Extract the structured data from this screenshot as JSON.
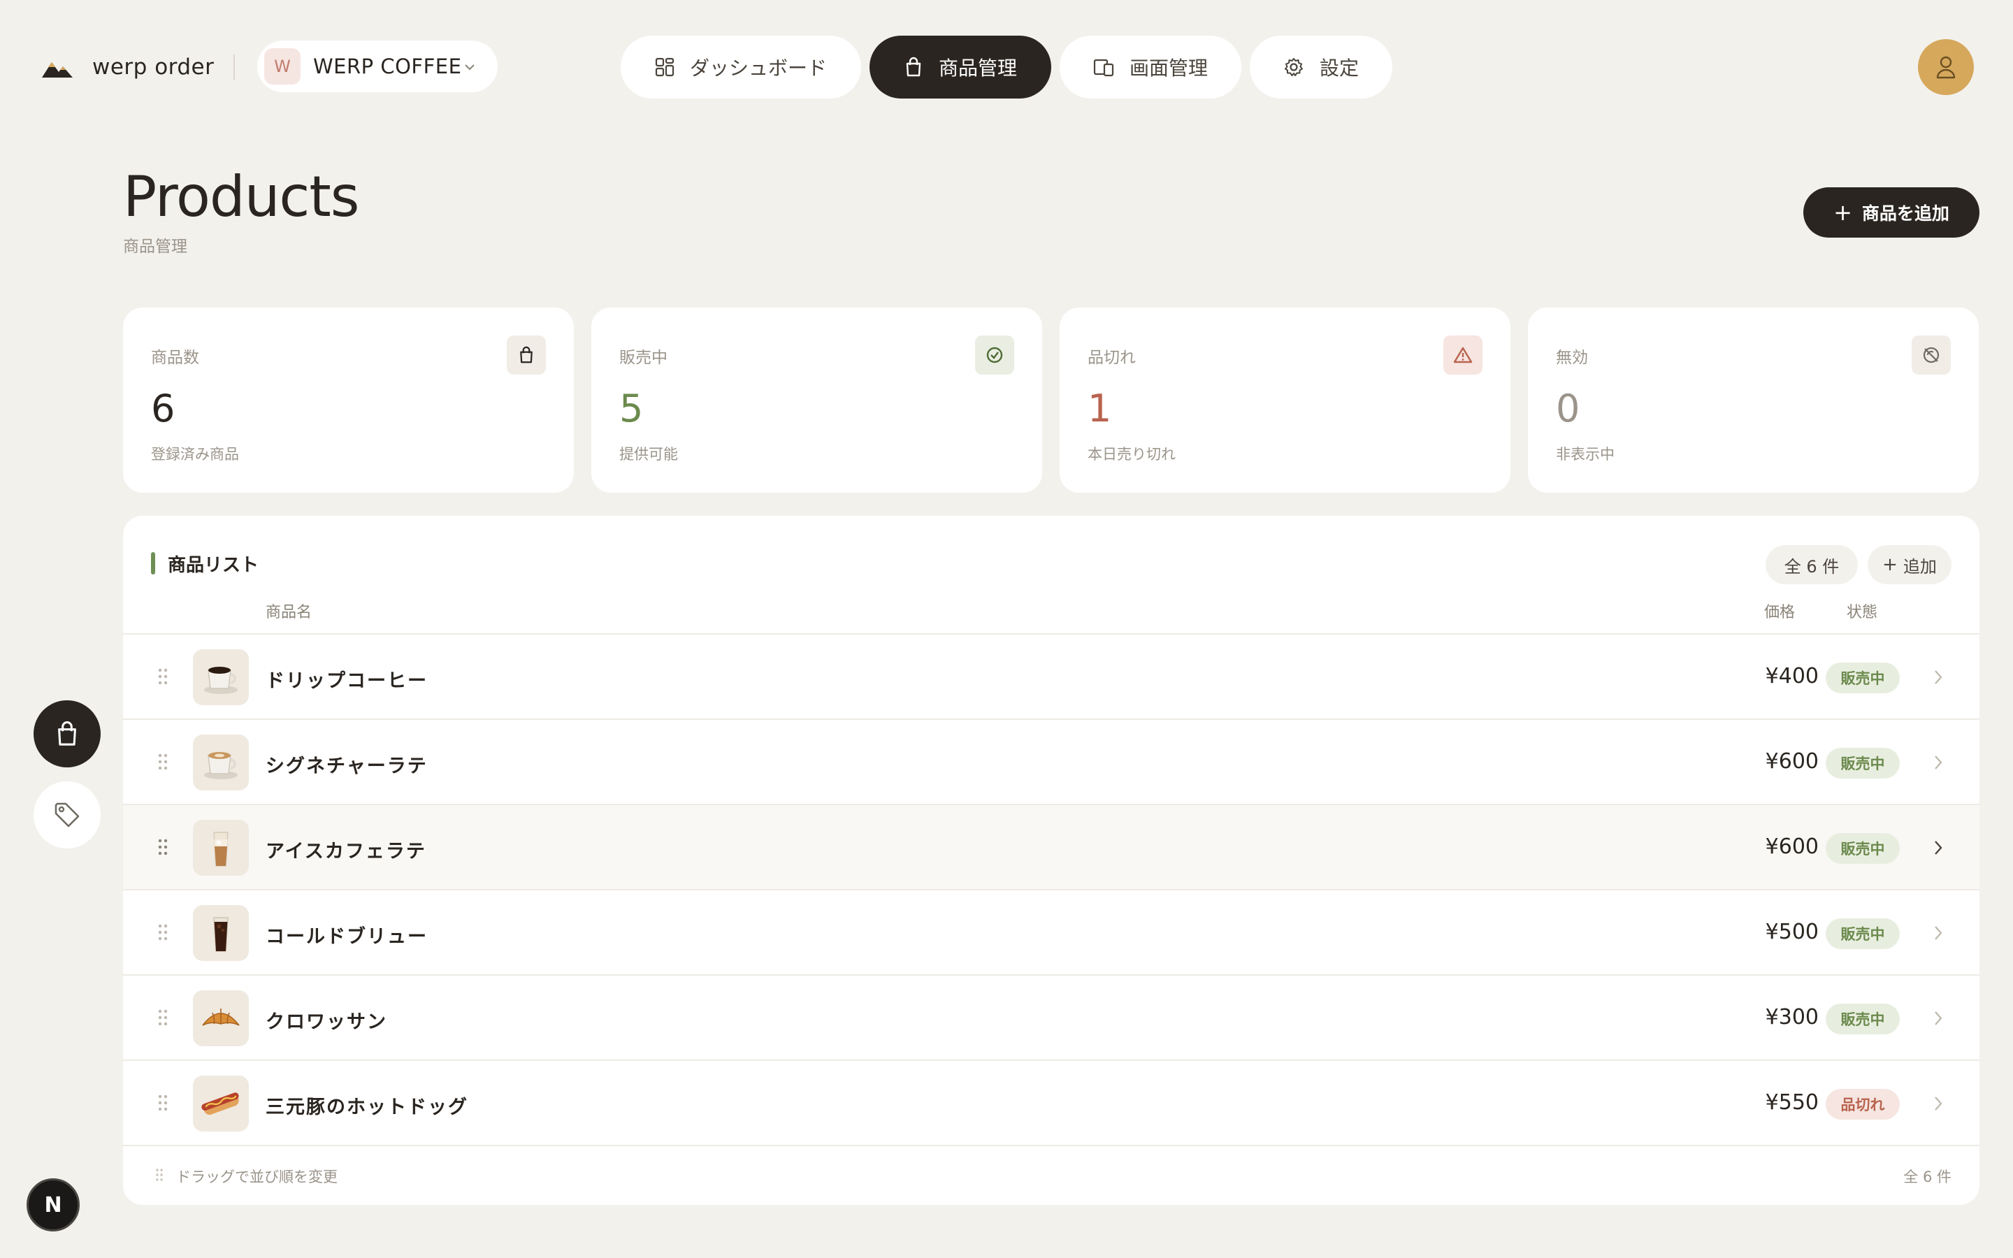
{
  "brand": {
    "name": "werp order"
  },
  "store": {
    "initial": "W",
    "name": "WERP COFFEE"
  },
  "nav": {
    "items": [
      {
        "label": "ダッシュボード",
        "icon": "dashboard-grid-icon"
      },
      {
        "label": "商品管理",
        "icon": "shopping-bag-icon",
        "active": true
      },
      {
        "label": "画面管理",
        "icon": "screens-icon"
      },
      {
        "label": "設定",
        "icon": "gear-icon"
      }
    ]
  },
  "page": {
    "title": "Products",
    "subtitle": "商品管理",
    "add_button_label": "商品を追加"
  },
  "stats": [
    {
      "label": "商品数",
      "value": "6",
      "sub": "登録済み商品",
      "icon": "shopping-bag-icon",
      "color": "#2a2520",
      "icon_bg": "#f1ede6"
    },
    {
      "label": "販売中",
      "value": "5",
      "sub": "提供可能",
      "icon": "check-circle-icon",
      "color": "#6b8a4d",
      "icon_bg": "#eaeee2"
    },
    {
      "label": "品切れ",
      "value": "1",
      "sub": "本日売り切れ",
      "icon": "warning-triangle-icon",
      "color": "#b9634e",
      "icon_bg": "#f6e5e0"
    },
    {
      "label": "無効",
      "value": "0",
      "sub": "非表示中",
      "icon": "hidden-circle-icon",
      "color": "#9a948a",
      "icon_bg": "#f1ede6"
    }
  ],
  "product_list": {
    "title": "商品リスト",
    "count_label": "全 6 件",
    "add_label": "追加",
    "columns": {
      "name": "商品名",
      "price": "価格",
      "status": "状態"
    },
    "rows": [
      {
        "name": "ドリップコーヒー",
        "price": "¥400",
        "status": "販売中",
        "state": "ok",
        "image": "hot-coffee-image"
      },
      {
        "name": "シグネチャーラテ",
        "price": "¥600",
        "status": "販売中",
        "state": "ok",
        "image": "latte-image"
      },
      {
        "name": "アイスカフェラテ",
        "price": "¥600",
        "status": "販売中",
        "state": "ok",
        "image": "iced-latte-image"
      },
      {
        "name": "コールドブリュー",
        "price": "¥500",
        "status": "販売中",
        "state": "ok",
        "image": "cold-brew-image"
      },
      {
        "name": "クロワッサン",
        "price": "¥300",
        "status": "販売中",
        "state": "ok",
        "image": "croissant-image"
      },
      {
        "name": "三元豚のホットドッグ",
        "price": "¥550",
        "status": "品切れ",
        "state": "out",
        "image": "hotdog-image"
      }
    ],
    "footer_hint": "ドラッグで並び順を変更",
    "footer_count": "全 6 件"
  },
  "rail": {
    "items": [
      "shopping-bag-icon",
      "tag-icon"
    ]
  },
  "dev_badge": "N",
  "colors": {
    "background": "#f3f1ec",
    "dark": "#2a2520",
    "accent_green": "#6f8f55",
    "avatar": "#d6a85c"
  }
}
